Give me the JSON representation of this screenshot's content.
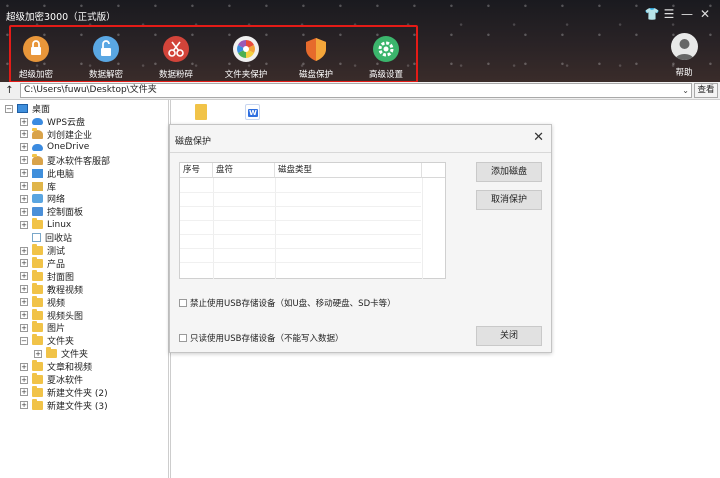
{
  "app": {
    "title": "超级加密3000（正式版）"
  },
  "window_controls": [
    "👕",
    "☰",
    "—",
    "✕"
  ],
  "toolbar": {
    "items": [
      {
        "label": "超级加密",
        "icon": "lock-icon",
        "color": "#e8963a"
      },
      {
        "label": "数据解密",
        "icon": "unlock-icon",
        "color": "#5aa7e3"
      },
      {
        "label": "数据粉碎",
        "icon": "scissors-icon",
        "color": "#d2443a"
      },
      {
        "label": "文件夹保护",
        "icon": "pinwheel-icon",
        "color": "#f0f0f0"
      },
      {
        "label": "磁盘保护",
        "icon": "shield-icon",
        "color": "#e66a2c"
      },
      {
        "label": "高级设置",
        "icon": "gear-icon",
        "color": "#3bb56c"
      }
    ],
    "help_label": "帮助"
  },
  "pathbar": {
    "up": "↑",
    "path": "C:\\Users\\fuwu\\Desktop\\文件夹",
    "view_label": "查看"
  },
  "tree": {
    "root": "桌面",
    "items": [
      {
        "label": "WPS云盘",
        "icon": "cloud"
      },
      {
        "label": "刘创建企业",
        "icon": "user"
      },
      {
        "label": "OneDrive",
        "icon": "cloud"
      },
      {
        "label": "夏冰软件客服部",
        "icon": "user"
      },
      {
        "label": "此电脑",
        "icon": "pc"
      },
      {
        "label": "库",
        "icon": "lib"
      },
      {
        "label": "网络",
        "icon": "net"
      },
      {
        "label": "控制面板",
        "icon": "ctl"
      },
      {
        "label": "Linux",
        "icon": "folder"
      },
      {
        "label": "回收站",
        "icon": "bin"
      },
      {
        "label": "测试",
        "icon": "folder"
      },
      {
        "label": "产品",
        "icon": "folder"
      },
      {
        "label": "封面图",
        "icon": "folder"
      },
      {
        "label": "教程视频",
        "icon": "folder"
      },
      {
        "label": "视频",
        "icon": "folder"
      },
      {
        "label": "视频头图",
        "icon": "folder"
      },
      {
        "label": "图片",
        "icon": "folder"
      },
      {
        "label": "文件夹",
        "icon": "folder"
      },
      {
        "label": "文件夹",
        "icon": "folder"
      },
      {
        "label": "文章和视频",
        "icon": "folder"
      },
      {
        "label": "夏冰软件",
        "icon": "folder"
      },
      {
        "label": "新建文件夹 (2)",
        "icon": "folder"
      },
      {
        "label": "新建文件夹 (3)",
        "icon": "folder"
      }
    ]
  },
  "dialog": {
    "title": "磁盘保护",
    "close": "✕",
    "columns": [
      "序号",
      "盘符",
      "磁盘类型"
    ],
    "add_label": "添加磁盘",
    "cancel_label": "取消保护",
    "option1": "禁止使用USB存储设备（如U盘、移动硬盘、SD卡等）",
    "option2": "只读使用USB存储设备（不能写入数据）",
    "close_label": "关闭"
  }
}
